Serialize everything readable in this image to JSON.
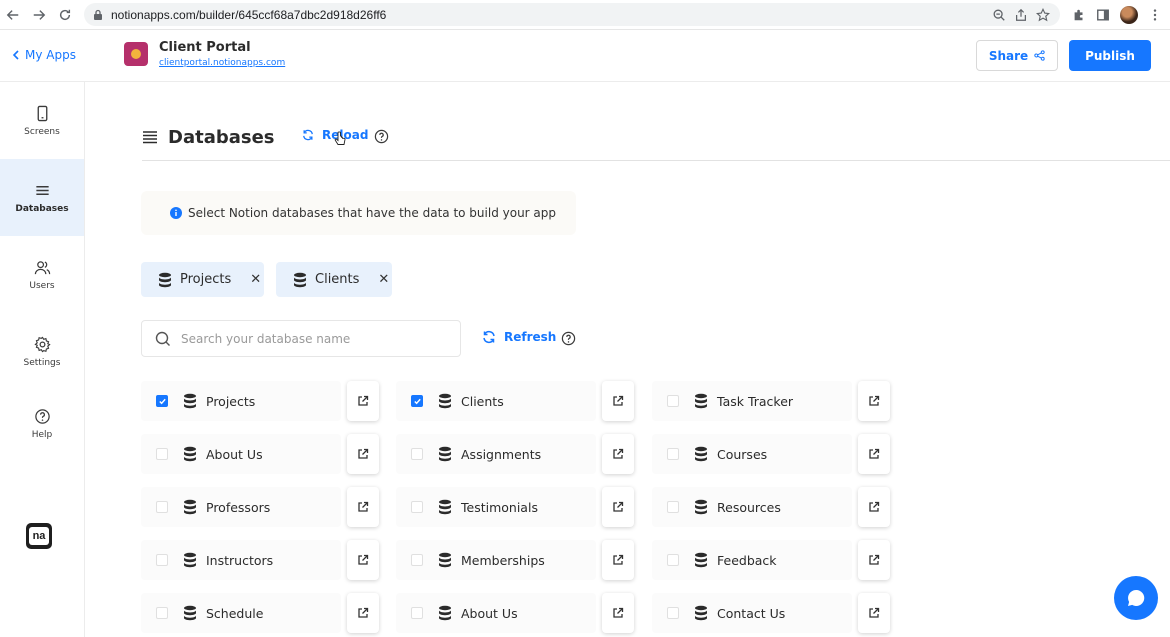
{
  "browser": {
    "url": "notionapps.com/builder/645ccf68a7dbc2d918d26ff6"
  },
  "header": {
    "back_label": "My Apps",
    "app_title": "Client Portal",
    "app_domain": "clientportal.notionapps.com",
    "share_label": "Share",
    "publish_label": "Publish",
    "accent": "#1677ff"
  },
  "sidebar": {
    "items": [
      {
        "label": "Screens",
        "icon": "mobile-icon"
      },
      {
        "label": "Databases",
        "icon": "menu-lines-icon",
        "active": true
      },
      {
        "label": "Users",
        "icon": "users-icon"
      },
      {
        "label": "Settings",
        "icon": "gear-icon"
      },
      {
        "label": "Help",
        "icon": "help-circle-icon"
      }
    ],
    "logo_text": "na"
  },
  "main": {
    "title": "Databases",
    "reload_label": "Reload",
    "info_text": "Select Notion databases that have the data to build your app",
    "selected_chips": [
      "Projects",
      "Clients"
    ],
    "search_placeholder": "Search your database name",
    "refresh_label": "Refresh",
    "databases": [
      [
        {
          "name": "Projects",
          "checked": true
        },
        {
          "name": "Clients",
          "checked": true
        },
        {
          "name": "Task Tracker",
          "checked": false
        }
      ],
      [
        {
          "name": "About Us",
          "checked": false
        },
        {
          "name": "Assignments",
          "checked": false
        },
        {
          "name": "Courses",
          "checked": false
        }
      ],
      [
        {
          "name": "Professors",
          "checked": false
        },
        {
          "name": "Testimonials",
          "checked": false
        },
        {
          "name": "Resources",
          "checked": false
        }
      ],
      [
        {
          "name": "Instructors",
          "checked": false
        },
        {
          "name": "Memberships",
          "checked": false
        },
        {
          "name": "Feedback",
          "checked": false
        }
      ],
      [
        {
          "name": "Schedule",
          "checked": false
        },
        {
          "name": "About Us",
          "checked": false
        },
        {
          "name": "Contact Us",
          "checked": false
        }
      ]
    ]
  }
}
